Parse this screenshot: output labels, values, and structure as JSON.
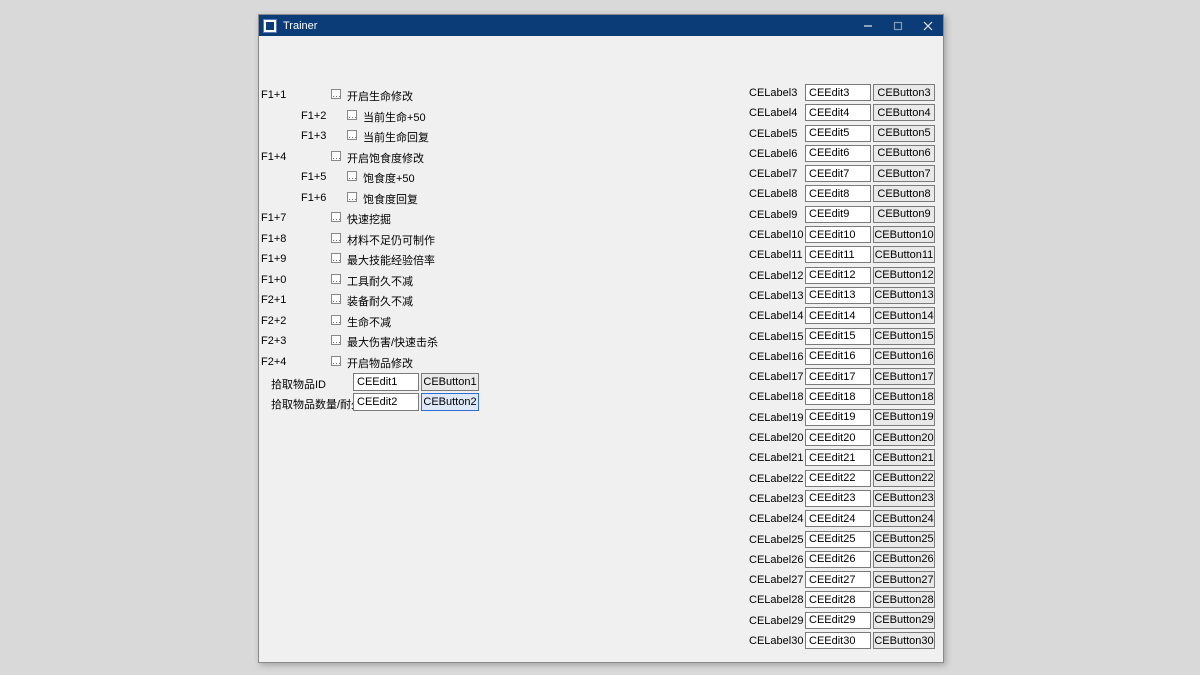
{
  "window": {
    "title": "Trainer"
  },
  "hotkeys": [
    {
      "key": "F1+1",
      "label": "开启生命修改",
      "sub": false
    },
    {
      "key": "F1+2",
      "label": "当前生命+50",
      "sub": true
    },
    {
      "key": "F1+3",
      "label": "当前生命回复",
      "sub": true
    },
    {
      "key": "F1+4",
      "label": "开启饱食度修改",
      "sub": false
    },
    {
      "key": "F1+5",
      "label": "饱食度+50",
      "sub": true
    },
    {
      "key": "F1+6",
      "label": "饱食度回复",
      "sub": true
    },
    {
      "key": "F1+7",
      "label": "快速挖掘",
      "sub": false
    },
    {
      "key": "F1+8",
      "label": "材料不足仍可制作",
      "sub": false
    },
    {
      "key": "F1+9",
      "label": "最大技能经验倍率",
      "sub": false
    },
    {
      "key": "F1+0",
      "label": "工具耐久不减",
      "sub": false
    },
    {
      "key": "F2+1",
      "label": "装备耐久不减",
      "sub": false
    },
    {
      "key": "F2+2",
      "label": "生命不减",
      "sub": false
    },
    {
      "key": "F2+3",
      "label": "最大伤害/快速击杀",
      "sub": false
    },
    {
      "key": "F2+4",
      "label": "开启物品修改",
      "sub": false
    }
  ],
  "left_edits": [
    {
      "label": "拾取物品ID",
      "edit": "CEEdit1",
      "button": "CEButton1",
      "focused": false
    },
    {
      "label": "拾取物品数量/耐久",
      "edit": "CEEdit2",
      "button": "CEButton2",
      "focused": true
    }
  ],
  "right_rows": [
    {
      "label": "CELabel3",
      "edit": "CEEdit3",
      "button": "CEButton3"
    },
    {
      "label": "CELabel4",
      "edit": "CEEdit4",
      "button": "CEButton4"
    },
    {
      "label": "CELabel5",
      "edit": "CEEdit5",
      "button": "CEButton5"
    },
    {
      "label": "CELabel6",
      "edit": "CEEdit6",
      "button": "CEButton6"
    },
    {
      "label": "CELabel7",
      "edit": "CEEdit7",
      "button": "CEButton7"
    },
    {
      "label": "CELabel8",
      "edit": "CEEdit8",
      "button": "CEButton8"
    },
    {
      "label": "CELabel9",
      "edit": "CEEdit9",
      "button": "CEButton9"
    },
    {
      "label": "CELabel10",
      "edit": "CEEdit10",
      "button": "CEButton10"
    },
    {
      "label": "CELabel11",
      "edit": "CEEdit11",
      "button": "CEButton11"
    },
    {
      "label": "CELabel12",
      "edit": "CEEdit12",
      "button": "CEButton12"
    },
    {
      "label": "CELabel13",
      "edit": "CEEdit13",
      "button": "CEButton13"
    },
    {
      "label": "CELabel14",
      "edit": "CEEdit14",
      "button": "CEButton14"
    },
    {
      "label": "CELabel15",
      "edit": "CEEdit15",
      "button": "CEButton15"
    },
    {
      "label": "CELabel16",
      "edit": "CEEdit16",
      "button": "CEButton16"
    },
    {
      "label": "CELabel17",
      "edit": "CEEdit17",
      "button": "CEButton17"
    },
    {
      "label": "CELabel18",
      "edit": "CEEdit18",
      "button": "CEButton18"
    },
    {
      "label": "CELabel19",
      "edit": "CEEdit19",
      "button": "CEButton19"
    },
    {
      "label": "CELabel20",
      "edit": "CEEdit20",
      "button": "CEButton20"
    },
    {
      "label": "CELabel21",
      "edit": "CEEdit21",
      "button": "CEButton21"
    },
    {
      "label": "CELabel22",
      "edit": "CEEdit22",
      "button": "CEButton22"
    },
    {
      "label": "CELabel23",
      "edit": "CEEdit23",
      "button": "CEButton23"
    },
    {
      "label": "CELabel24",
      "edit": "CEEdit24",
      "button": "CEButton24"
    },
    {
      "label": "CELabel25",
      "edit": "CEEdit25",
      "button": "CEButton25"
    },
    {
      "label": "CELabel26",
      "edit": "CEEdit26",
      "button": "CEButton26"
    },
    {
      "label": "CELabel27",
      "edit": "CEEdit27",
      "button": "CEButton27"
    },
    {
      "label": "CELabel28",
      "edit": "CEEdit28",
      "button": "CEButton28"
    },
    {
      "label": "CELabel29",
      "edit": "CEEdit29",
      "button": "CEButton29"
    },
    {
      "label": "CELabel30",
      "edit": "CEEdit30",
      "button": "CEButton30"
    }
  ]
}
